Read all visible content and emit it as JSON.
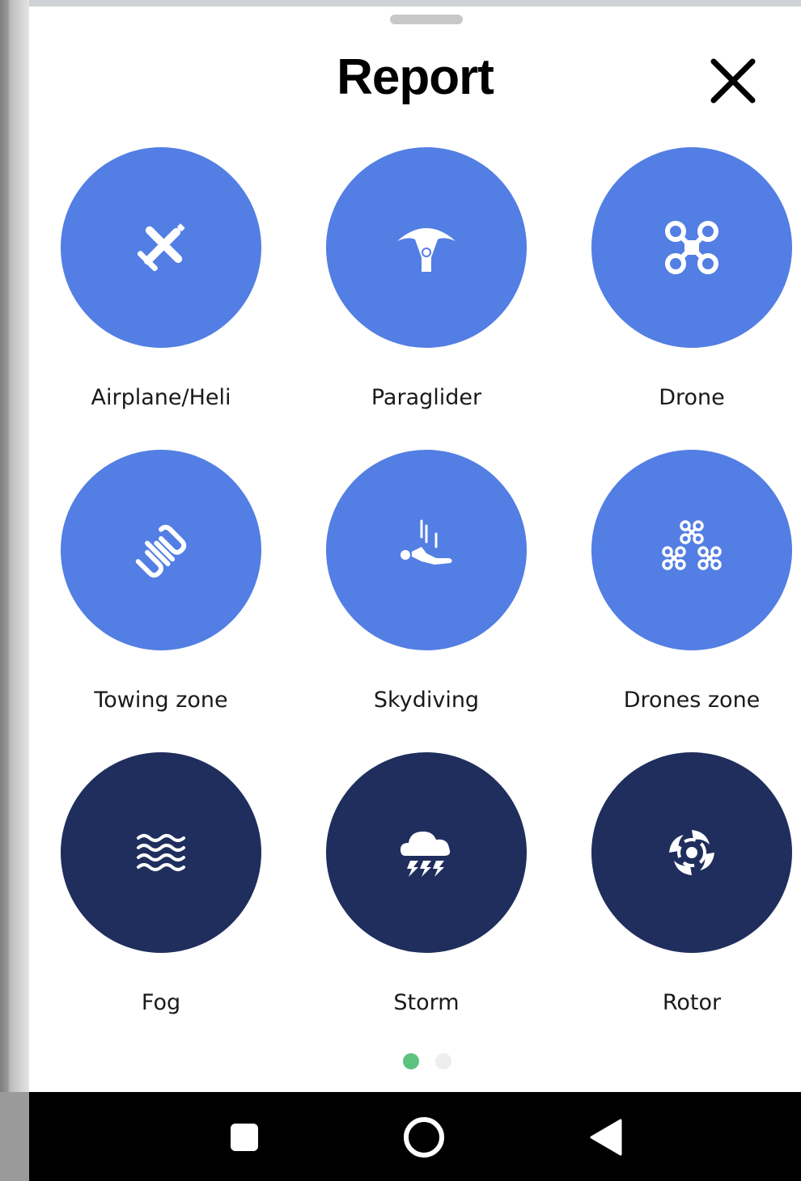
{
  "sheet": {
    "title": "Report",
    "close_icon": "close-icon"
  },
  "items": [
    {
      "label": "Airplane/Heli",
      "icon": "airplane-icon",
      "color": "#537ee3"
    },
    {
      "label": "Paraglider",
      "icon": "paraglider-icon",
      "color": "#537ee3"
    },
    {
      "label": "Drone",
      "icon": "drone-icon",
      "color": "#537ee3"
    },
    {
      "label": "Towing zone",
      "icon": "towing-icon",
      "color": "#537ee3"
    },
    {
      "label": "Skydiving",
      "icon": "skydiving-icon",
      "color": "#537ee3"
    },
    {
      "label": "Drones zone",
      "icon": "drones-zone-icon",
      "color": "#537ee3"
    },
    {
      "label": "Fog",
      "icon": "fog-icon",
      "color": "#1f2e5c"
    },
    {
      "label": "Storm",
      "icon": "storm-icon",
      "color": "#1f2e5c"
    },
    {
      "label": "Rotor",
      "icon": "rotor-icon",
      "color": "#1f2e5c"
    }
  ],
  "pagination": {
    "pages": 2,
    "active_page": 1,
    "active_color": "#5cc37f",
    "inactive_color": "#eeeeee"
  },
  "system_nav": {
    "buttons": [
      "recents-icon",
      "home-icon",
      "back-icon"
    ]
  }
}
